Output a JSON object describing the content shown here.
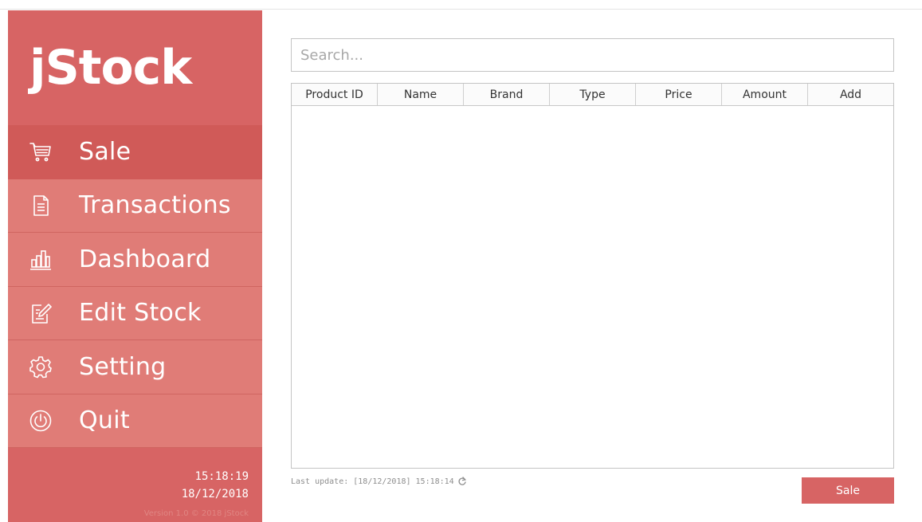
{
  "app": {
    "logo": "jStock"
  },
  "sidebar": {
    "items": [
      {
        "label": "Sale",
        "icon": "shopping-cart-icon",
        "active": true
      },
      {
        "label": "Transactions",
        "icon": "document-icon",
        "active": false
      },
      {
        "label": "Dashboard",
        "icon": "bar-chart-icon",
        "active": false
      },
      {
        "label": "Edit Stock",
        "icon": "edit-icon",
        "active": false
      },
      {
        "label": "Setting",
        "icon": "gear-icon",
        "active": false
      },
      {
        "label": "Quit",
        "icon": "power-icon",
        "active": false
      }
    ],
    "time": "15:18:19",
    "date": "18/12/2018",
    "version": "Version 1.0 © 2018 jStock"
  },
  "search": {
    "placeholder": "Search..."
  },
  "table": {
    "columns": [
      "Product ID",
      "Name",
      "Brand",
      "Type",
      "Price",
      "Amount",
      "Add"
    ],
    "rows": []
  },
  "footer": {
    "last_update": "Last update: [18/12/2018] 15:18:14",
    "sale_button": "Sale"
  },
  "colors": {
    "sidebar": "#d76464",
    "nav_item": "#e07c77",
    "nav_active": "#d05a58",
    "accent": "#d76464"
  }
}
